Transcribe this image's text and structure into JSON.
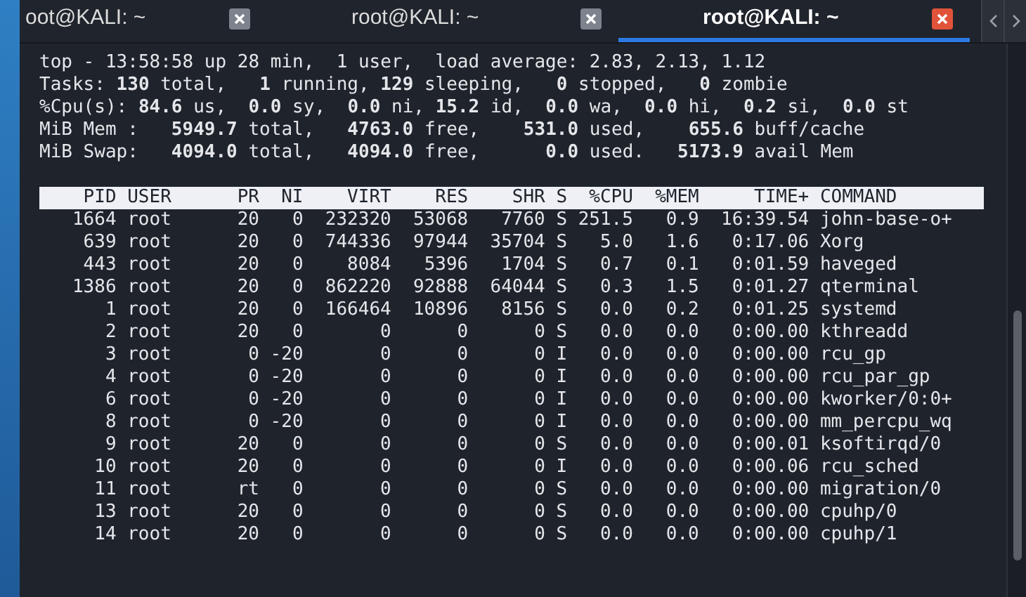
{
  "tabs": [
    {
      "label": "oot@KALI: ~",
      "selected": false
    },
    {
      "label": "root@KALI: ~",
      "selected": false
    },
    {
      "label": "root@KALI: ~",
      "selected": true
    }
  ],
  "summary_lines": [
    "top - 13:58:58 up 28 min,  1 user,  load average: 2.83, 2.13, 1.12",
    "Tasks: **130** total,   **1** running, **129** sleeping,   **0** stopped,   **0** zombie",
    "%Cpu(s): **84.6** us,  **0.0** sy,  **0.0** ni, **15.2** id,  **0.0** wa,  **0.0** hi,  **0.2** si,  **0.0** st",
    "MiB Mem :   **5949.7** total,   **4763.0** free,    **531.0** used,    **655.6** buff/cache",
    "MiB Swap:   **4094.0** total,   **4094.0** free,      **0.0** used.   **5173.9** avail Mem"
  ],
  "table": {
    "columns": [
      "PID",
      "USER",
      "PR",
      "NI",
      "VIRT",
      "RES",
      "SHR",
      "S",
      "%CPU",
      "%MEM",
      "TIME+",
      "COMMAND"
    ],
    "rows": [
      [
        "1664",
        "root",
        "20",
        "0",
        "232320",
        "53068",
        "7760",
        "S",
        "251.5",
        "0.9",
        "16:39.54",
        "john-base-o+"
      ],
      [
        "639",
        "root",
        "20",
        "0",
        "744336",
        "97944",
        "35704",
        "S",
        "5.0",
        "1.6",
        "0:17.06",
        "Xorg"
      ],
      [
        "443",
        "root",
        "20",
        "0",
        "8084",
        "5396",
        "1704",
        "S",
        "0.7",
        "0.1",
        "0:01.59",
        "haveged"
      ],
      [
        "1386",
        "root",
        "20",
        "0",
        "862220",
        "92888",
        "64044",
        "S",
        "0.3",
        "1.5",
        "0:01.27",
        "qterminal"
      ],
      [
        "1",
        "root",
        "20",
        "0",
        "166464",
        "10896",
        "8156",
        "S",
        "0.0",
        "0.2",
        "0:01.25",
        "systemd"
      ],
      [
        "2",
        "root",
        "20",
        "0",
        "0",
        "0",
        "0",
        "S",
        "0.0",
        "0.0",
        "0:00.00",
        "kthreadd"
      ],
      [
        "3",
        "root",
        "0",
        "-20",
        "0",
        "0",
        "0",
        "I",
        "0.0",
        "0.0",
        "0:00.00",
        "rcu_gp"
      ],
      [
        "4",
        "root",
        "0",
        "-20",
        "0",
        "0",
        "0",
        "I",
        "0.0",
        "0.0",
        "0:00.00",
        "rcu_par_gp"
      ],
      [
        "6",
        "root",
        "0",
        "-20",
        "0",
        "0",
        "0",
        "I",
        "0.0",
        "0.0",
        "0:00.00",
        "kworker/0:0+"
      ],
      [
        "8",
        "root",
        "0",
        "-20",
        "0",
        "0",
        "0",
        "I",
        "0.0",
        "0.0",
        "0:00.00",
        "mm_percpu_wq"
      ],
      [
        "9",
        "root",
        "20",
        "0",
        "0",
        "0",
        "0",
        "S",
        "0.0",
        "0.0",
        "0:00.01",
        "ksoftirqd/0"
      ],
      [
        "10",
        "root",
        "20",
        "0",
        "0",
        "0",
        "0",
        "I",
        "0.0",
        "0.0",
        "0:00.06",
        "rcu_sched"
      ],
      [
        "11",
        "root",
        "rt",
        "0",
        "0",
        "0",
        "0",
        "S",
        "0.0",
        "0.0",
        "0:00.00",
        "migration/0"
      ],
      [
        "13",
        "root",
        "20",
        "0",
        "0",
        "0",
        "0",
        "S",
        "0.0",
        "0.0",
        "0:00.00",
        "cpuhp/0"
      ],
      [
        "14",
        "root",
        "20",
        "0",
        "0",
        "0",
        "0",
        "S",
        "0.0",
        "0.0",
        "0:00.00",
        "cpuhp/1"
      ]
    ]
  }
}
